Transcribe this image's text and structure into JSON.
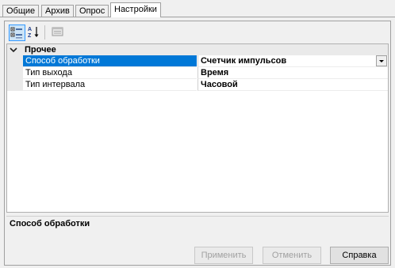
{
  "tabs": [
    {
      "label": "Общие"
    },
    {
      "label": "Архив"
    },
    {
      "label": "Опрос"
    },
    {
      "label": "Настройки",
      "active": true
    }
  ],
  "toolbar": {
    "categorized_icon": "categorized-view-icon",
    "sort_icon": "alphabetical-sort-icon",
    "pages_icon": "property-pages-icon"
  },
  "property_grid": {
    "category": "Прочее",
    "properties": [
      {
        "name": "Способ обработки",
        "value": "Счетчик импульсов",
        "selected": true,
        "has_dropdown": true
      },
      {
        "name": "Тип выхода",
        "value": "Время"
      },
      {
        "name": "Тип интервала",
        "value": "Часовой"
      }
    ]
  },
  "description": {
    "title": "Способ обработки",
    "text": ""
  },
  "buttons": {
    "apply": "Применить",
    "cancel": "Отменить",
    "help": "Справка"
  },
  "colors": {
    "selection": "#0078d7",
    "window_bg": "#f0f0f0",
    "grid_bg": "#ffffff"
  }
}
